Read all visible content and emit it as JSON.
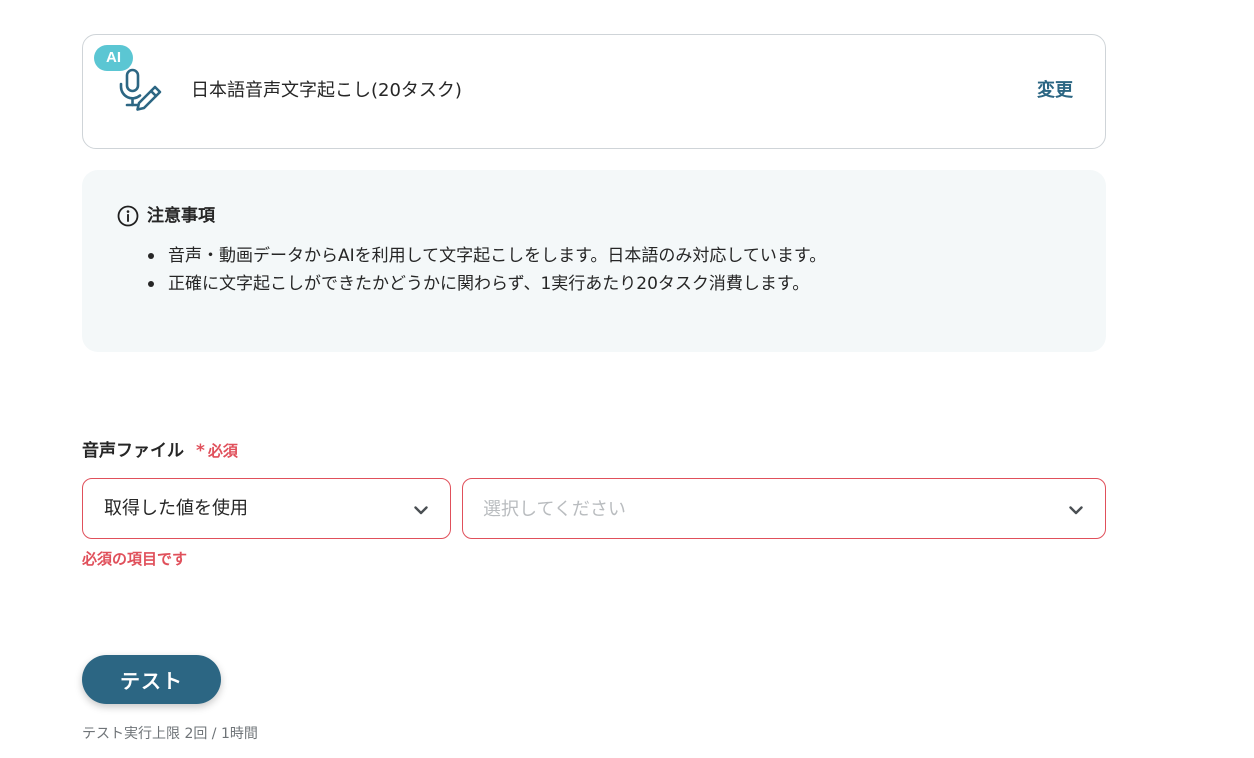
{
  "action": {
    "badge": "AI",
    "icon": "mic-pen-icon",
    "title": "日本語音声文字起こし(20タスク)",
    "change_label": "変更"
  },
  "notice": {
    "icon": "info-icon",
    "title": "注意事項",
    "items": [
      "音声・動画データからAIを利用して文字起こしをします。日本語のみ対応しています。",
      "正確に文字起こしができたかどうかに関わらず、1実行あたり20タスク消費します。"
    ]
  },
  "field": {
    "label": "音声ファイル",
    "required_mark": "*",
    "required_label": "必須",
    "source_select": {
      "value": "取得した値を使用",
      "icon": "chevron-down-icon"
    },
    "value_select": {
      "placeholder": "選択してください",
      "icon": "chevron-down-icon"
    },
    "error": "必須の項目です"
  },
  "test": {
    "button_label": "テスト",
    "limit_note": "テスト実行上限 2回 / 1時間"
  },
  "colors": {
    "primary": "#2c6683",
    "accent_badge": "#5bc6d3",
    "error": "#e0505b",
    "notice_bg": "#f4f8f9",
    "border": "#cfd4d8"
  }
}
